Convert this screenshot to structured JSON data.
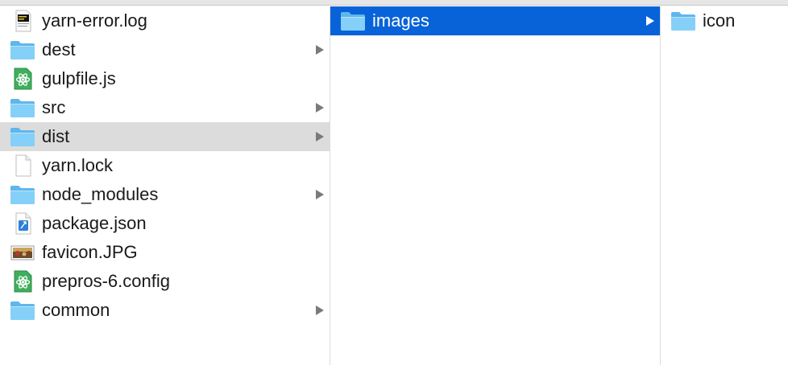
{
  "columns": [
    {
      "items": [
        {
          "name": "yarn-error.log",
          "icon": "log-file-icon",
          "has_children": false,
          "state": "normal"
        },
        {
          "name": "dest",
          "icon": "folder-icon",
          "has_children": true,
          "state": "normal"
        },
        {
          "name": "gulpfile.js",
          "icon": "atom-file-icon",
          "has_children": false,
          "state": "normal"
        },
        {
          "name": "src",
          "icon": "folder-icon",
          "has_children": true,
          "state": "normal"
        },
        {
          "name": "dist",
          "icon": "folder-icon",
          "has_children": true,
          "state": "hovered"
        },
        {
          "name": "yarn.lock",
          "icon": "blank-file-icon",
          "has_children": false,
          "state": "normal"
        },
        {
          "name": "node_modules",
          "icon": "folder-icon",
          "has_children": true,
          "state": "normal"
        },
        {
          "name": "package.json",
          "icon": "json-file-icon",
          "has_children": false,
          "state": "normal"
        },
        {
          "name": "favicon.JPG",
          "icon": "image-file-icon",
          "has_children": false,
          "state": "normal"
        },
        {
          "name": "prepros-6.config",
          "icon": "atom-file-icon",
          "has_children": false,
          "state": "normal"
        },
        {
          "name": "common",
          "icon": "folder-icon",
          "has_children": true,
          "state": "normal"
        }
      ]
    },
    {
      "items": [
        {
          "name": "images",
          "icon": "folder-icon",
          "has_children": true,
          "state": "selected"
        }
      ]
    },
    {
      "items": [
        {
          "name": "icon",
          "icon": "folder-icon",
          "has_children": false,
          "state": "normal"
        }
      ]
    }
  ],
  "colors": {
    "selection": "#0863d8",
    "hover": "#dcdcdc",
    "folder": "#6cc4f4",
    "arrow": "#7a7a7a"
  }
}
